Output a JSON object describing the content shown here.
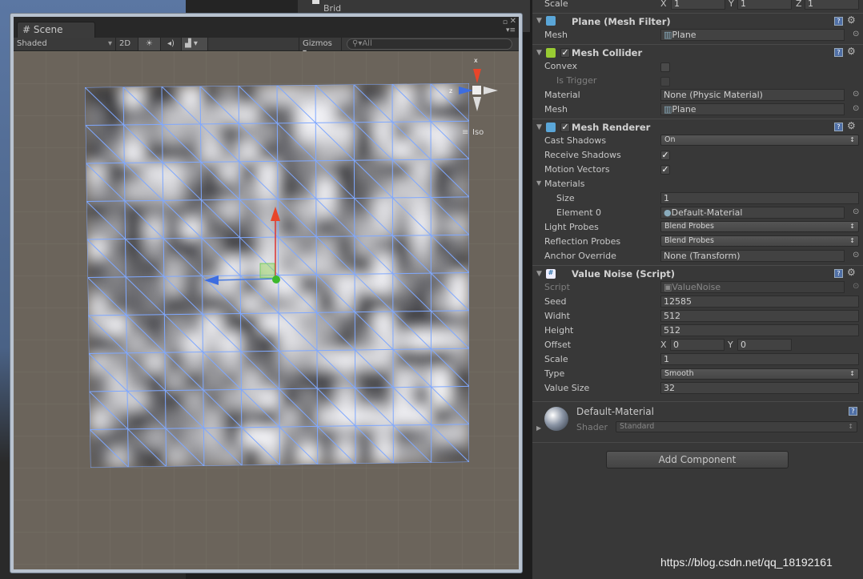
{
  "background": {
    "hierarchy_item": "Brid"
  },
  "scene": {
    "tab_label": "Scene",
    "shading_mode": "Shaded",
    "toggle_2d": "2D",
    "gizmos_label": "Gizmos",
    "search_placeholder": "All",
    "iso_label": "Iso",
    "gizmo_axes": {
      "x": "x",
      "z": "z"
    }
  },
  "inspector": {
    "transform_scale": {
      "label": "Scale",
      "x": "1",
      "y": "1",
      "z": "1"
    },
    "mesh_filter": {
      "title": "Plane (Mesh Filter)",
      "mesh_label": "Mesh",
      "mesh_value": "Plane"
    },
    "mesh_collider": {
      "title": "Mesh Collider",
      "enabled": true,
      "convex_label": "Convex",
      "convex": false,
      "is_trigger_label": "Is Trigger",
      "is_trigger": false,
      "material_label": "Material",
      "material_value": "None (Physic Material)",
      "mesh_label": "Mesh",
      "mesh_value": "Plane"
    },
    "mesh_renderer": {
      "title": "Mesh Renderer",
      "enabled": true,
      "cast_shadows_label": "Cast Shadows",
      "cast_shadows": "On",
      "receive_shadows_label": "Receive Shadows",
      "receive_shadows": true,
      "motion_vectors_label": "Motion Vectors",
      "motion_vectors": true,
      "materials_label": "Materials",
      "size_label": "Size",
      "size_value": "1",
      "element0_label": "Element 0",
      "element0_value": "Default-Material",
      "light_probes_label": "Light Probes",
      "light_probes": "Blend Probes",
      "reflection_probes_label": "Reflection Probes",
      "reflection_probes": "Blend Probes",
      "anchor_override_label": "Anchor Override",
      "anchor_override": "None (Transform)"
    },
    "value_noise": {
      "title": "Value Noise (Script)",
      "script_label": "Script",
      "script_value": "ValueNoise",
      "seed_label": "Seed",
      "seed": "12585",
      "width_label": "Widht",
      "width": "512",
      "height_label": "Height",
      "height": "512",
      "offset_label": "Offset",
      "offset_x": "0",
      "offset_y": "0",
      "scale_label": "Scale",
      "scale": "1",
      "type_label": "Type",
      "type": "Smooth",
      "value_size_label": "Value Size",
      "value_size": "32"
    },
    "material": {
      "name": "Default-Material",
      "shader_label": "Shader",
      "shader": "Standard"
    },
    "add_component": "Add Component"
  },
  "watermark": "https://blog.csdn.net/qq_18192161"
}
